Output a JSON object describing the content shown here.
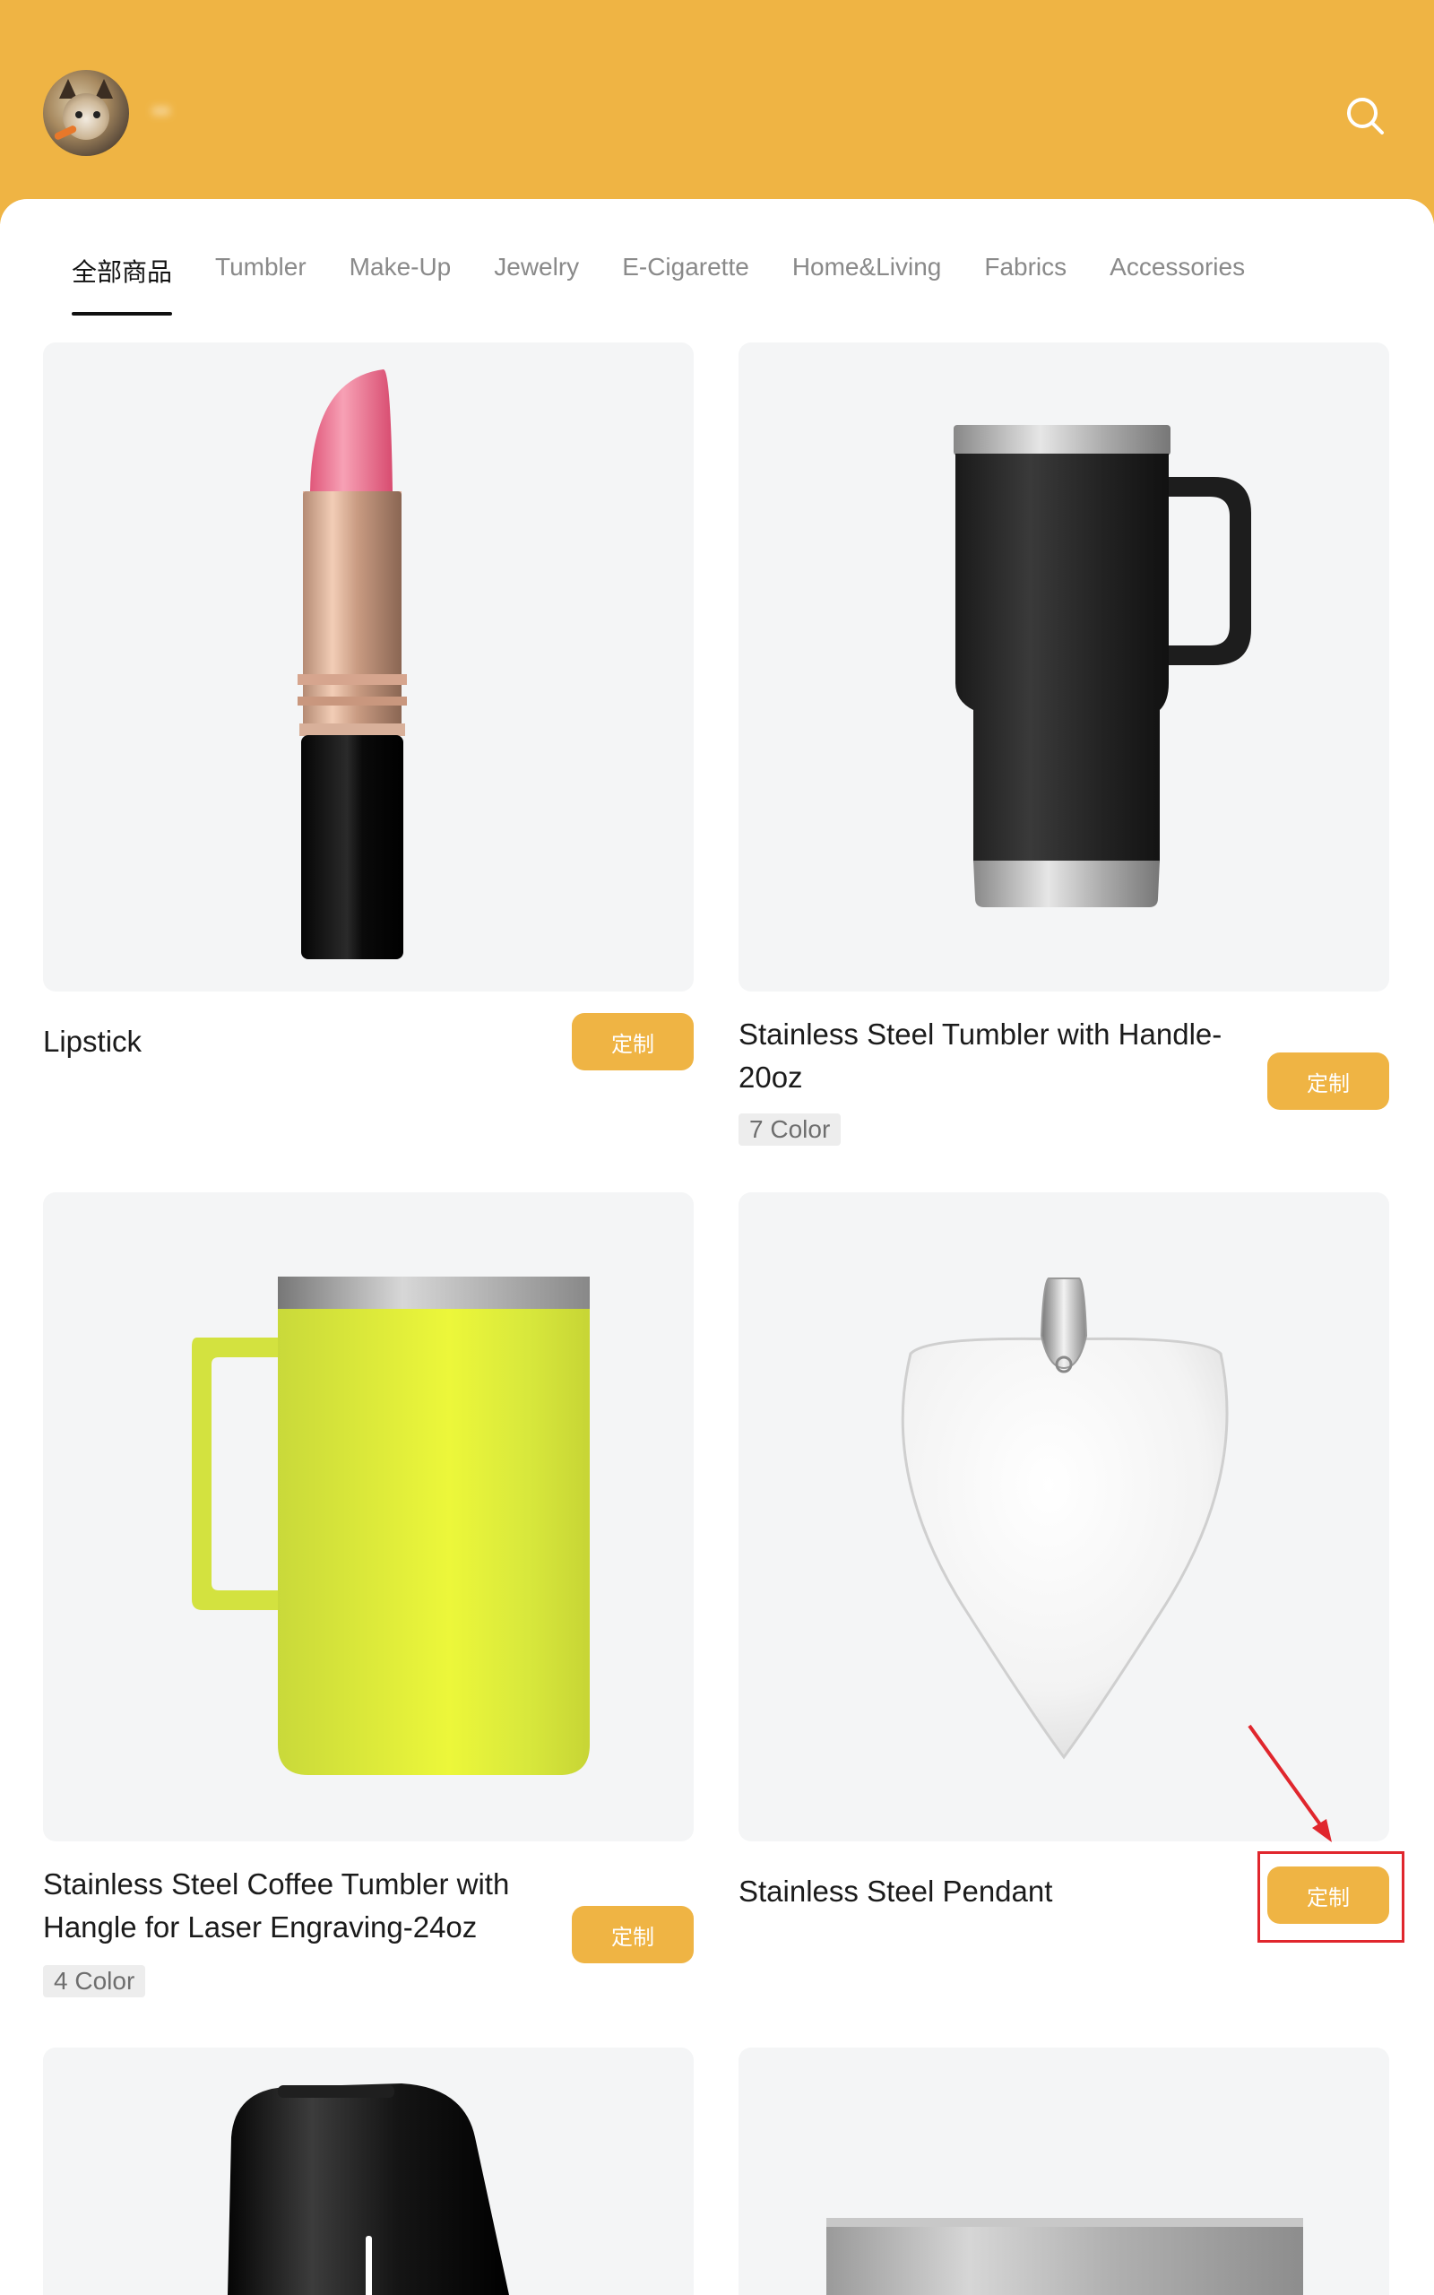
{
  "header": {
    "username": "••",
    "search_icon": "search-icon",
    "bg_color": "#EFB444"
  },
  "tabs": [
    {
      "label": "全部商品",
      "active": true
    },
    {
      "label": "Tumbler"
    },
    {
      "label": "Make-Up"
    },
    {
      "label": "Jewelry"
    },
    {
      "label": "E-Cigarette"
    },
    {
      "label": "Home&Living"
    },
    {
      "label": "Fabrics"
    },
    {
      "label": "Accessories"
    }
  ],
  "products": [
    {
      "name": "Lipstick",
      "button": "定制",
      "image": "lipstick"
    },
    {
      "name": "Stainless Steel Tumbler with Handle-20oz",
      "colors": "7 Color",
      "button": "定制",
      "image": "black-tumbler-with-handle"
    },
    {
      "name": "Stainless Steel Coffee Tumbler with Hangle for Laser Engraving-24oz",
      "colors": "4 Color",
      "button": "定制",
      "image": "yellow-coffee-mug"
    },
    {
      "name": "Stainless Steel Pendant",
      "button": "定制",
      "image": "heart-pendant"
    },
    {
      "image": "e-cigarette-device"
    },
    {
      "image": "steel-plate"
    }
  ],
  "annotation": {
    "color": "#E0262D",
    "target": "Stainless Steel Pendant 定制 button"
  }
}
